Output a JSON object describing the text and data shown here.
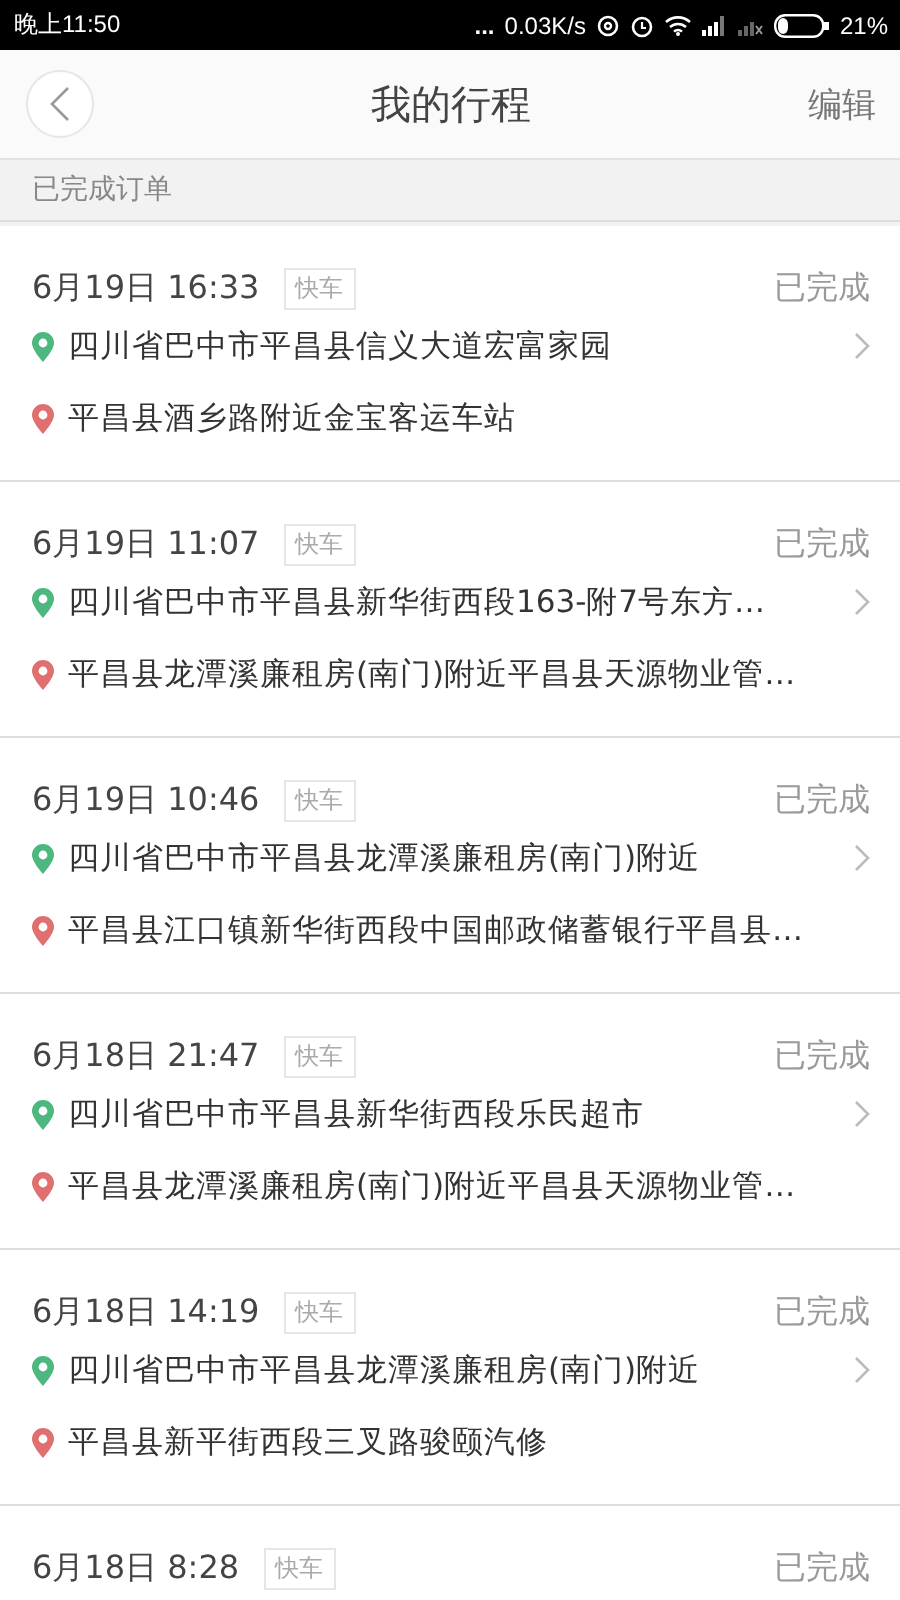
{
  "status_bar": {
    "time": "晚上11:50",
    "dots": "...",
    "speed": "0.03K/s",
    "battery": "21%"
  },
  "nav": {
    "title": "我的行程",
    "action": "编辑"
  },
  "section": "已完成订单",
  "trips": [
    {
      "time": "6月19日 16:33",
      "tag": "快车",
      "status": "已完成",
      "from": "四川省巴中市平昌县信义大道宏富家园",
      "to": "平昌县酒乡路附近金宝客运车站"
    },
    {
      "time": "6月19日 11:07",
      "tag": "快车",
      "status": "已完成",
      "from": "四川省巴中市平昌县新华街西段163-附7号东方…",
      "to": "平昌县龙潭溪廉租房(南门)附近平昌县天源物业管…"
    },
    {
      "time": "6月19日 10:46",
      "tag": "快车",
      "status": "已完成",
      "from": "四川省巴中市平昌县龙潭溪廉租房(南门)附近",
      "to": "平昌县江口镇新华街西段中国邮政储蓄银行平昌县…"
    },
    {
      "time": "6月18日 21:47",
      "tag": "快车",
      "status": "已完成",
      "from": "四川省巴中市平昌县新华街西段乐民超市",
      "to": "平昌县龙潭溪廉租房(南门)附近平昌县天源物业管…"
    },
    {
      "time": "6月18日 14:19",
      "tag": "快车",
      "status": "已完成",
      "from": "四川省巴中市平昌县龙潭溪廉租房(南门)附近",
      "to": "平昌县新平街西段三叉路骏颐汽修"
    },
    {
      "time": "6月18日 8:28",
      "tag": "快车",
      "status": "已完成"
    }
  ]
}
